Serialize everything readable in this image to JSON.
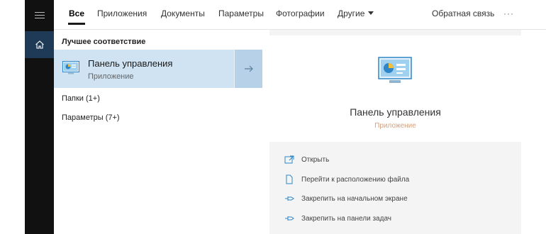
{
  "tabs": [
    {
      "label": "Все"
    },
    {
      "label": "Приложения"
    },
    {
      "label": "Документы"
    },
    {
      "label": "Параметры"
    },
    {
      "label": "Фотографии"
    },
    {
      "label": "Другие"
    }
  ],
  "header": {
    "feedback": "Обратная связь",
    "more": "···"
  },
  "results": {
    "section_title": "Лучшее соответствие",
    "best": {
      "title": "Панель управления",
      "subtitle": "Приложение"
    },
    "categories": [
      {
        "label": "Папки (1+)"
      },
      {
        "label": "Параметры (7+)"
      }
    ]
  },
  "preview": {
    "title": "Панель управления",
    "subtitle": "Приложение",
    "actions": [
      {
        "label": "Открыть",
        "icon": "open-icon"
      },
      {
        "label": "Перейти к расположению файла",
        "icon": "file-location-icon"
      },
      {
        "label": "Закрепить на начальном экране",
        "icon": "pin-icon"
      },
      {
        "label": "Закрепить на панели задач",
        "icon": "pin-icon"
      }
    ]
  },
  "colors": {
    "accent": "#2e86c9",
    "selection": "#cfe3f2",
    "sidebar": "#111111",
    "subtitle_orange": "#d7a07a"
  }
}
